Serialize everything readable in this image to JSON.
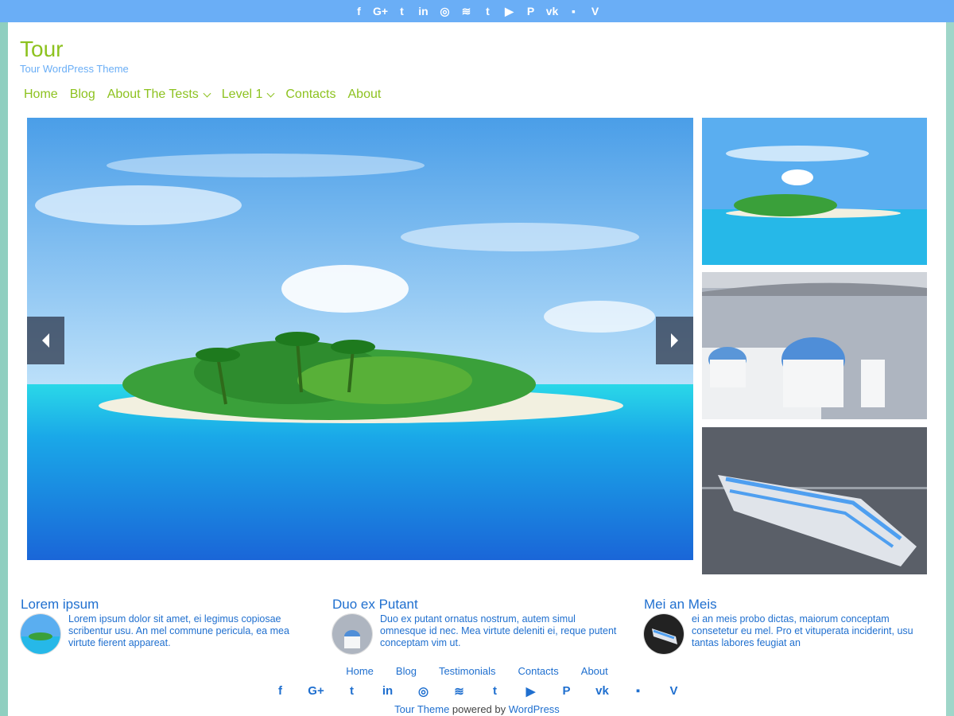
{
  "social_top": [
    "f",
    "G+",
    "t",
    "in",
    "◎",
    "≋",
    "t",
    "▶",
    "P",
    "vk",
    "▪",
    "V"
  ],
  "social_icon_names": [
    "facebook-icon",
    "google-plus-icon",
    "twitter-icon",
    "linkedin-icon",
    "instagram-icon",
    "rss-icon",
    "tumblr-icon",
    "youtube-icon",
    "pinterest-icon",
    "vk-icon",
    "flickr-icon",
    "vine-icon"
  ],
  "site": {
    "title": "Tour",
    "description": "Tour WordPress Theme"
  },
  "nav": {
    "home": "Home",
    "blog": "Blog",
    "about_tests": "About The Tests",
    "level1": "Level 1",
    "contacts": "Contacts",
    "about": "About"
  },
  "features": [
    {
      "title": "Lorem ipsum",
      "text": "Lorem ipsum dolor sit amet, ei legimus copiosae scribentur usu. An mel commune pericula, ea mea virtute fierent appareat."
    },
    {
      "title": "Duo ex Putant",
      "text": "Duo ex putant ornatus nostrum, autem simul omnesque id nec. Mea virtute deleniti ei, reque putent conceptam vim ut."
    },
    {
      "title": "Mei an Meis",
      "text": "ei an meis probo dictas, maiorum conceptam consetetur eu mel. Pro et vituperata inciderint, usu tantas labores feugiat an"
    }
  ],
  "footer_nav": {
    "home": "Home",
    "blog": "Blog",
    "testimonials": "Testimonials",
    "contacts": "Contacts",
    "about": "About"
  },
  "credit": {
    "theme": "Tour Theme",
    "powered": " powered by ",
    "wp": "WordPress"
  },
  "colors": {
    "accent_green": "#8dc21f",
    "accent_blue": "#1f6fcf",
    "topbar": "#6aaef6"
  }
}
